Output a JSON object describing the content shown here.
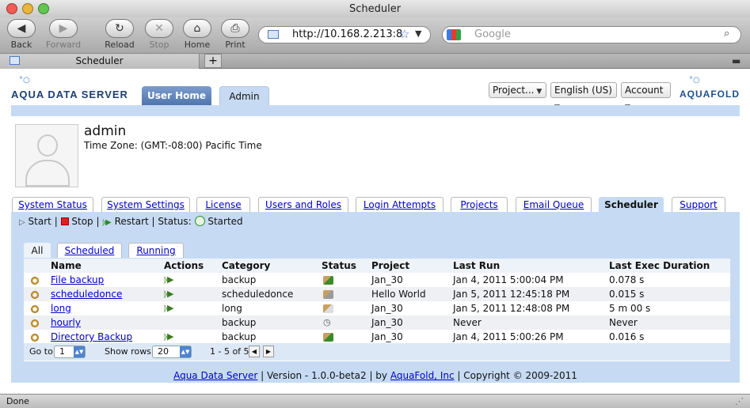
{
  "window": {
    "title": "Scheduler"
  },
  "toolbar": {
    "back": "Back",
    "forward": "Forward",
    "reload": "Reload",
    "stop": "Stop",
    "home": "Home",
    "print": "Print",
    "url": "http://10.168.2.213:8",
    "search_placeholder": "Google"
  },
  "browser_tab": {
    "label": "Scheduler"
  },
  "header": {
    "logo_left": "AQUA DATA SERVER",
    "logo_right": "AQUAFOLD",
    "tab_user_home": "User Home",
    "tab_admin": "Admin",
    "project_select": "Project...",
    "language_select": "English (US)",
    "account_select": "Account"
  },
  "user": {
    "name": "admin",
    "timezone": "Time Zone: (GMT:-08:00) Pacific Time"
  },
  "main_tabs": [
    "System Status",
    "System Settings",
    "License",
    "Users and Roles",
    "Login Attempts",
    "Projects",
    "Email Queue",
    "Scheduler",
    "Support"
  ],
  "controls": {
    "start": "Start",
    "stop": "Stop",
    "restart": "Restart",
    "status_label": "Status:",
    "status_value": "Started",
    "sep": "|"
  },
  "sub_tabs": [
    "All",
    "Scheduled",
    "Running"
  ],
  "table": {
    "headers": [
      "Name",
      "Actions",
      "Category",
      "Status",
      "Project",
      "Last Run",
      "Last Exec Duration"
    ],
    "rows": [
      {
        "name": "File backup",
        "category": "backup",
        "project": "Jan_30",
        "last_run": "Jan 4, 2011 5:00:04 PM",
        "duration": "0.078 s",
        "actions": true
      },
      {
        "name": "scheduledonce",
        "category": "scheduledonce",
        "project": "Hello World",
        "last_run": "Jan 5, 2011 12:45:18 PM",
        "duration": "0.015 s",
        "actions": true
      },
      {
        "name": "long",
        "category": "long",
        "project": "Jan_30",
        "last_run": "Jan 5, 2011 12:48:08 PM",
        "duration": "5 m 00 s",
        "actions": true
      },
      {
        "name": "hourly",
        "category": "backup",
        "project": "Jan_30",
        "last_run": "Never",
        "duration": "Never",
        "actions": false
      },
      {
        "name": "Directory Backup",
        "category": "backup",
        "project": "Jan_30",
        "last_run": "Jan 4, 2011 5:00:26 PM",
        "duration": "0.016 s",
        "actions": true
      }
    ]
  },
  "pager": {
    "goto_label": "Go to",
    "goto_value": "1",
    "rows_label": "Show rows",
    "rows_value": "20",
    "range": "1 - 5 of 5"
  },
  "footer": {
    "product": "Aqua Data Server",
    "version": "| Version - 1.0.0-beta2 | by",
    "company": "AquaFold, Inc",
    "copyright": "| Copyright © 2009-2011"
  },
  "statusbar": {
    "text": "Done"
  },
  "colors": {
    "accent_blue": "#c6dbf3",
    "admin_tab": "#5b7fb5",
    "link": "#0000cc"
  }
}
